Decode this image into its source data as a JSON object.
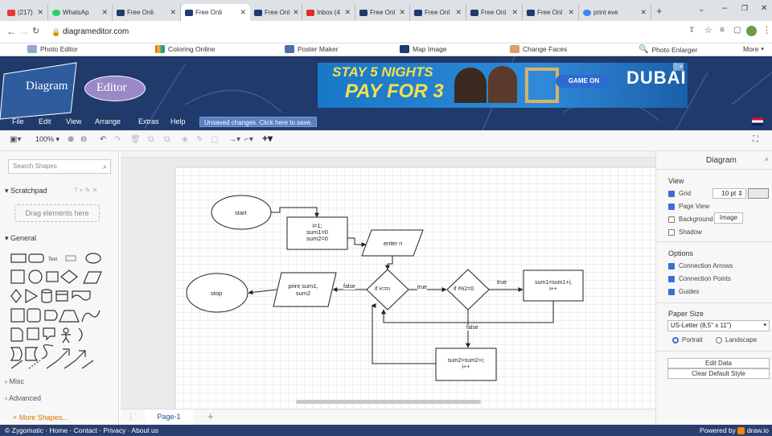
{
  "browser": {
    "tabs": [
      {
        "label": "(217)",
        "fav": "#e53935"
      },
      {
        "label": "WhatsAp",
        "fav": "#25d366"
      },
      {
        "label": "Free Onli",
        "fav": "#1f3a6b"
      },
      {
        "label": "Free Onli",
        "fav": "#1f3a6b",
        "active": true
      },
      {
        "label": "Free Onl",
        "fav": "#1f3a6b"
      },
      {
        "label": "Inbox (4",
        "fav": "#d93025"
      },
      {
        "label": "Free Onl",
        "fav": "#1f3a6b"
      },
      {
        "label": "Free Onl",
        "fav": "#1f3a6b"
      },
      {
        "label": "Free Onl",
        "fav": "#1f3a6b"
      },
      {
        "label": "Free Onl",
        "fav": "#1f3a6b"
      },
      {
        "label": "print eve",
        "fav": "#4285f4"
      }
    ],
    "url": "diagrameditor.com",
    "bookmarks": [
      "Photo Editor",
      "Coloring Online",
      "Poster Maker",
      "Map Image",
      "Change Faces",
      "Photo Enlarger",
      "More"
    ]
  },
  "header": {
    "logo_part1": "Diagram",
    "logo_part2": "Editor",
    "ad_line1": "STAY 5 NIGHTS",
    "ad_line2": "PAY FOR 3",
    "ad_button": "GAME ON",
    "ad_brand": "DUBAI"
  },
  "menu": {
    "items": [
      "File",
      "Edit",
      "View",
      "Arrange",
      "Extras",
      "Help"
    ],
    "unsaved": "Unsaved changes. Click here to save."
  },
  "toolbar": {
    "zoom": "100%"
  },
  "left": {
    "search_placeholder": "Search Shapes",
    "scratchpad": "Scratchpad",
    "drag_hint": "Drag elements here",
    "general": "General",
    "misc": "Misc",
    "advanced": "Advanced",
    "more_shapes": "+ More Shapes...",
    "text_shape": "Text"
  },
  "diagram": {
    "start": "start",
    "init": [
      "i=1;",
      "sum1=0",
      "sum2=0"
    ],
    "enter": "enter n",
    "cond1": "if i<=n",
    "cond2": "if i%2=0",
    "true1": "true",
    "true2": "true",
    "false1": "false",
    "false2": "false",
    "sum1": [
      "sum1=sum1+i;",
      "i++"
    ],
    "sum2": [
      "sum2=sum2+i;",
      "i++"
    ],
    "print": [
      "print sum1,",
      "sum2"
    ],
    "stop": "stop"
  },
  "pagetab": "Page-1",
  "right": {
    "title": "Diagram",
    "view": "View",
    "grid": "Grid",
    "grid_size": "10 pt",
    "page_view": "Page View",
    "background": "Background",
    "image_btn": "Image",
    "shadow": "Shadow",
    "options": "Options",
    "conn_arrows": "Connection Arrows",
    "conn_points": "Connection Points",
    "guides": "Guides",
    "paper_size": "Paper Size",
    "paper_value": "US-Letter (8,5\" x 11\")",
    "portrait": "Portrait",
    "landscape": "Landscape",
    "edit_data": "Edit Data",
    "clear_style": "Clear Default Style"
  },
  "footer": {
    "left": "© Zygomatic · Home · Contact · Privacy · About us",
    "right": "Powered by",
    "brand": "draw.io"
  },
  "colors": {
    "header_bg": "#1f3a6b",
    "accent": "#3b6fd8",
    "logo_ellipse": "#9b88c6"
  }
}
